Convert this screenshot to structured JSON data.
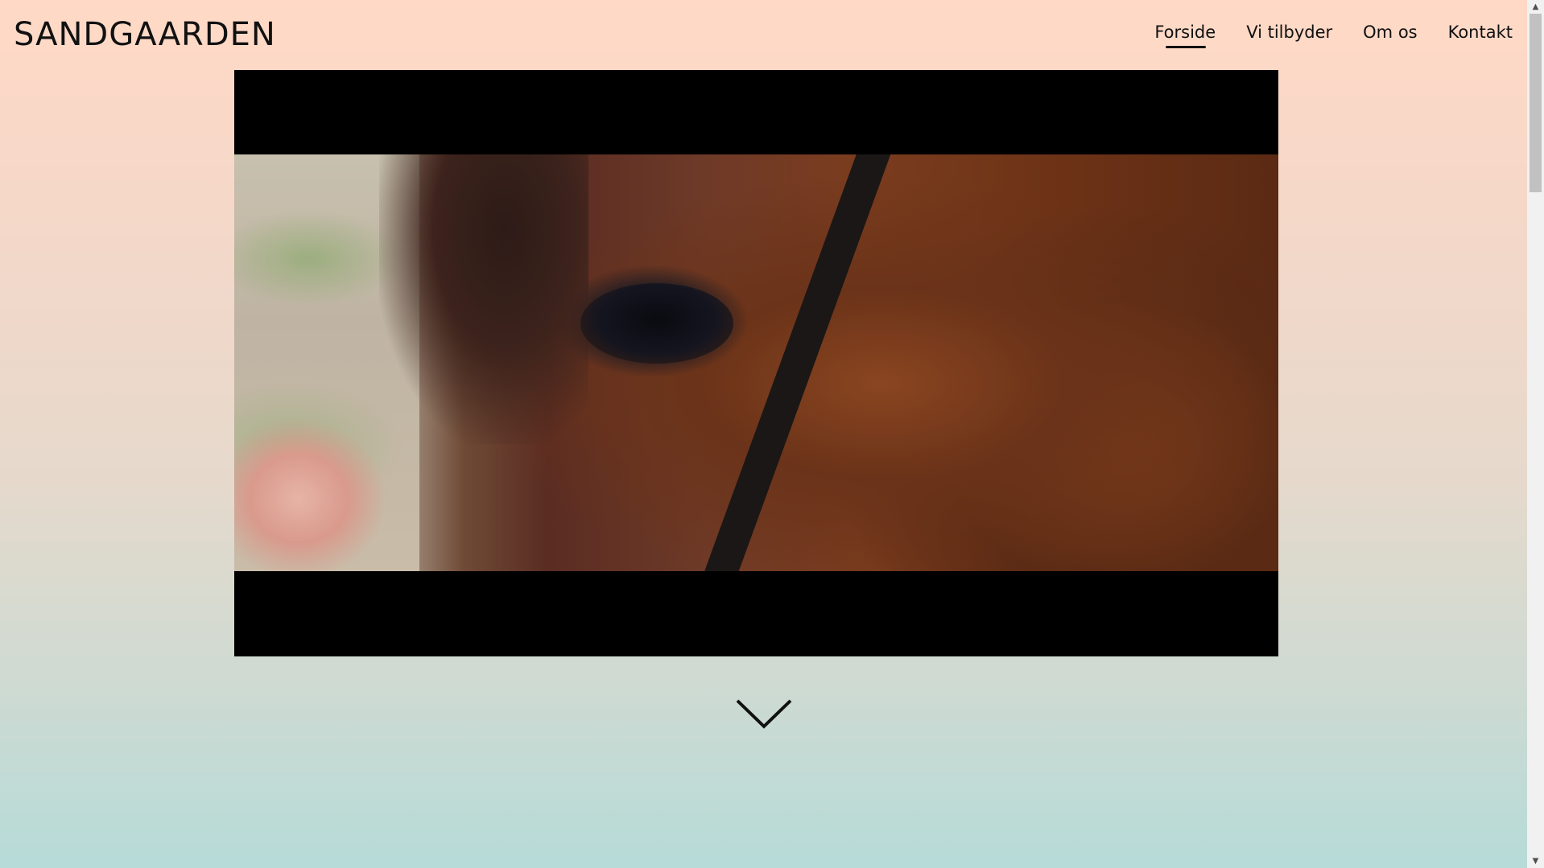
{
  "site": {
    "brand": "SANDGAARDEN"
  },
  "nav": {
    "items": [
      {
        "label": "Forside",
        "active": true
      },
      {
        "label": "Vi tilbyder",
        "active": false
      },
      {
        "label": "Om os",
        "active": false
      },
      {
        "label": "Kontakt",
        "active": false
      }
    ]
  },
  "hero": {
    "media": "video of horse eye close-up",
    "scroll_icon": "chevron-down-icon"
  },
  "colors": {
    "text": "#111111",
    "gradient_top": "#ffd9c6",
    "gradient_bottom": "#b6dbd8",
    "video_bg": "#000000"
  }
}
